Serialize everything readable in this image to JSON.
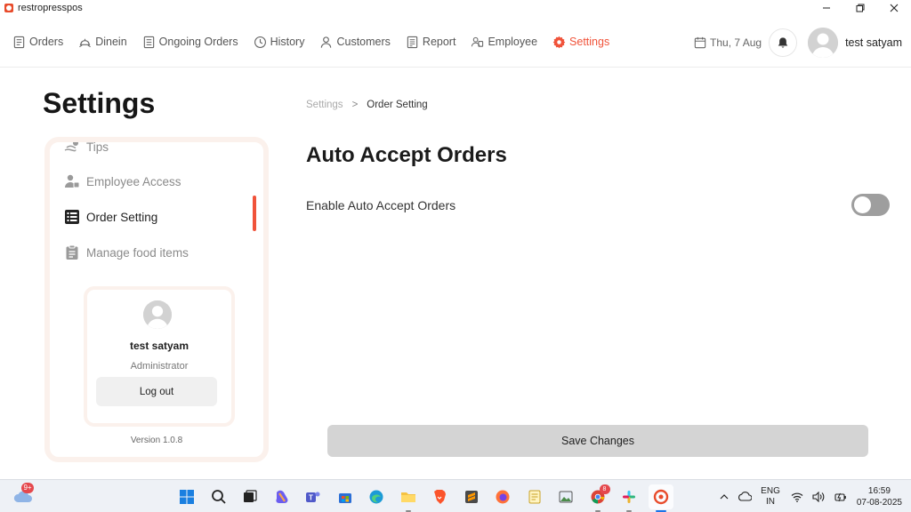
{
  "window": {
    "title": "restropresspos"
  },
  "nav": {
    "items": [
      {
        "label": "Orders",
        "icon": "orders-icon"
      },
      {
        "label": "Dinein",
        "icon": "dinein-icon"
      },
      {
        "label": "Ongoing Orders",
        "icon": "ongoing-orders-icon"
      },
      {
        "label": "History",
        "icon": "history-icon"
      },
      {
        "label": "Customers",
        "icon": "customers-icon"
      },
      {
        "label": "Report",
        "icon": "report-icon"
      },
      {
        "label": "Employee",
        "icon": "employee-icon"
      },
      {
        "label": "Settings",
        "icon": "gear-icon",
        "active": true
      }
    ],
    "date": "Thu, 7 Aug",
    "user_name": "test satyam"
  },
  "page": {
    "title": "Settings"
  },
  "sidebar": {
    "items": [
      {
        "label": "Tips",
        "icon": "tips-icon"
      },
      {
        "label": "Employee Access",
        "icon": "employee-access-icon"
      },
      {
        "label": "Order Setting",
        "icon": "list-icon",
        "active": true
      },
      {
        "label": "Manage food items",
        "icon": "clipboard-icon"
      }
    ],
    "profile": {
      "name": "test satyam",
      "role": "Administrator",
      "logout_label": "Log out"
    },
    "version": "Version 1.0.8"
  },
  "breadcrumb": {
    "parent": "Settings",
    "separator": ">",
    "current": "Order Setting"
  },
  "content": {
    "section_title": "Auto Accept Orders",
    "setting_label": "Enable Auto Accept Orders",
    "auto_accept_enabled": false,
    "save_label": "Save Changes"
  },
  "taskbar": {
    "weather_badge": "9+",
    "chrome_badge": "8",
    "language": {
      "line1": "ENG",
      "line2": "IN"
    },
    "clock": {
      "time": "16:59",
      "date": "07-08-2025"
    }
  },
  "colors": {
    "accent": "#f0533a",
    "toggle_off": "#9e9e9e",
    "button_bg": "#d4d4d4"
  }
}
